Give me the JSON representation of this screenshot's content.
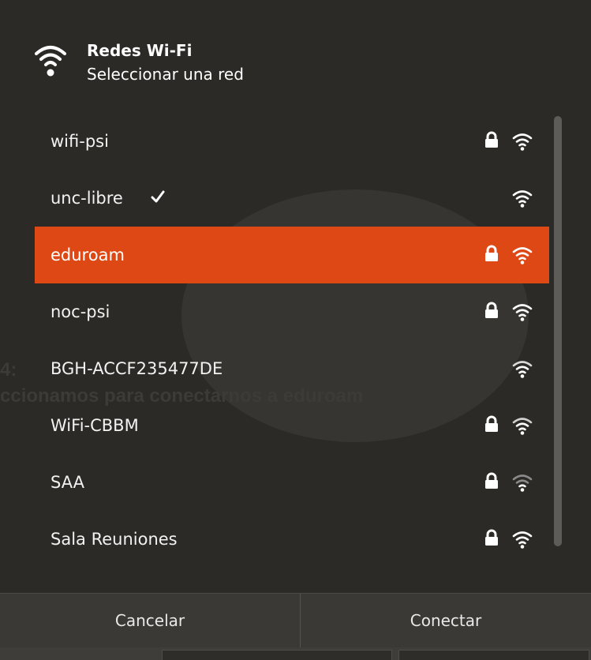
{
  "header": {
    "title": "Redes Wi-Fi",
    "subtitle": "Seleccionar una red",
    "icon": "wifi-icon"
  },
  "networks": [
    {
      "name": "wifi-psi",
      "secured": true,
      "connected": false,
      "selected": false,
      "signal": "strong"
    },
    {
      "name": "unc-libre",
      "secured": false,
      "connected": true,
      "selected": false,
      "signal": "strong"
    },
    {
      "name": "eduroam",
      "secured": true,
      "connected": false,
      "selected": true,
      "signal": "strong"
    },
    {
      "name": "noc-psi",
      "secured": true,
      "connected": false,
      "selected": false,
      "signal": "strong"
    },
    {
      "name": "BGH-ACCF235477DE",
      "secured": false,
      "connected": false,
      "selected": false,
      "signal": "strong"
    },
    {
      "name": "WiFi-CBBM",
      "secured": true,
      "connected": false,
      "selected": false,
      "signal": "strong"
    },
    {
      "name": "SAA",
      "secured": true,
      "connected": false,
      "selected": false,
      "signal": "medium"
    },
    {
      "name": "Sala Reuniones",
      "secured": true,
      "connected": false,
      "selected": false,
      "signal": "strong"
    }
  ],
  "footer": {
    "cancel_label": "Cancelar",
    "connect_label": "Conectar"
  },
  "colors": {
    "background": "#2b2a27",
    "selected_row": "#dd4814",
    "text": "#ffffff"
  }
}
